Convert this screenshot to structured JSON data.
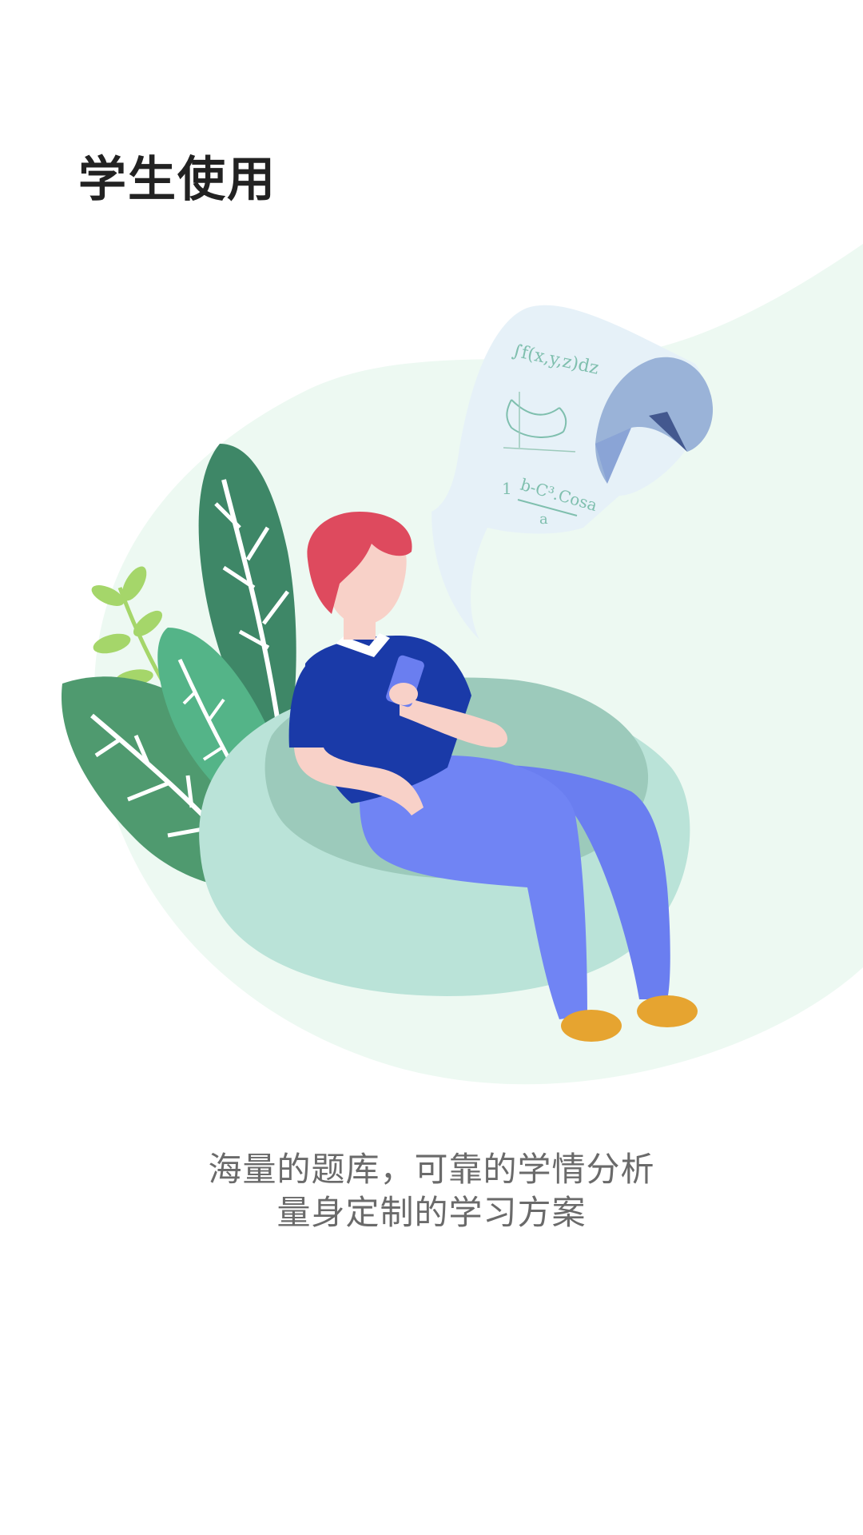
{
  "page": {
    "title": "学生使用",
    "subtitle_line1": "海量的题库，可靠的学情分析",
    "subtitle_line2": "量身定制的学习方案"
  },
  "illustration": {
    "subject": "student-on-beanbag",
    "formula_top": "∫f(x,y,z)dz",
    "formula_bottom": "b-C³.Cosa",
    "formula_prefix": "1",
    "formula_denominator": "a",
    "colors": {
      "background_blob": "#edf9f2",
      "beanbag_light": "#bae3d8",
      "beanbag_dark": "#9ccabb",
      "leaf_dark": "#3e8767",
      "leaf_mid": "#4f9a6f",
      "leaf_light": "#54b488",
      "sprig": "#a5d66a",
      "hair": "#de4a5e",
      "skin": "#f8d1c8",
      "shirt": "#1a3aa8",
      "pants": "#7084f4",
      "shoes": "#e6a430",
      "paper": "#e6f1f8",
      "paper_curl": "#9ab3d8",
      "paper_curl_dark": "#43588f"
    }
  }
}
